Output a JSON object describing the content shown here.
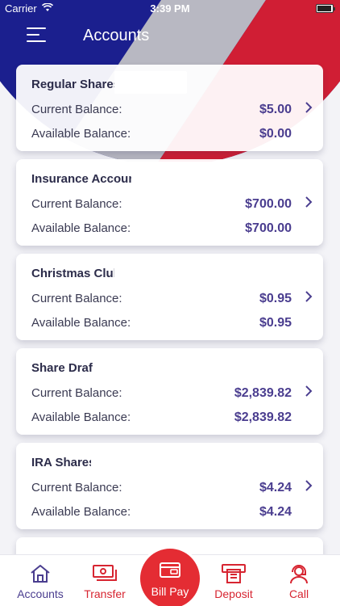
{
  "status_bar": {
    "carrier": "Carrier",
    "time": "3:39 PM"
  },
  "nav": {
    "title": "Accounts"
  },
  "accounts": [
    {
      "name": "Regular Shares",
      "current_label": "Current Balance:",
      "current_value": "$5.00",
      "available_label": "Available Balance:",
      "available_value": "$0.00"
    },
    {
      "name": "Insurance Account",
      "current_label": "Current Balance:",
      "current_value": "$700.00",
      "available_label": "Available Balance:",
      "available_value": "$700.00"
    },
    {
      "name": "Christmas Club",
      "current_label": "Current Balance:",
      "current_value": "$0.95",
      "available_label": "Available Balance:",
      "available_value": "$0.95"
    },
    {
      "name": "Share Draft",
      "current_label": "Current Balance:",
      "current_value": "$2,839.82",
      "available_label": "Available Balance:",
      "available_value": "$2,839.82"
    },
    {
      "name": "IRA Shares",
      "current_label": "Current Balance:",
      "current_value": "$4.24",
      "available_label": "Available Balance:",
      "available_value": "$4.24"
    }
  ],
  "tabs": {
    "accounts": "Accounts",
    "transfer": "Transfer",
    "billpay": "Bill Pay",
    "deposit": "Deposit",
    "call": "Call"
  },
  "colors": {
    "primary": "#4a3d8f",
    "accent_red": "#d72531",
    "header_blue": "#1a1f8c"
  }
}
